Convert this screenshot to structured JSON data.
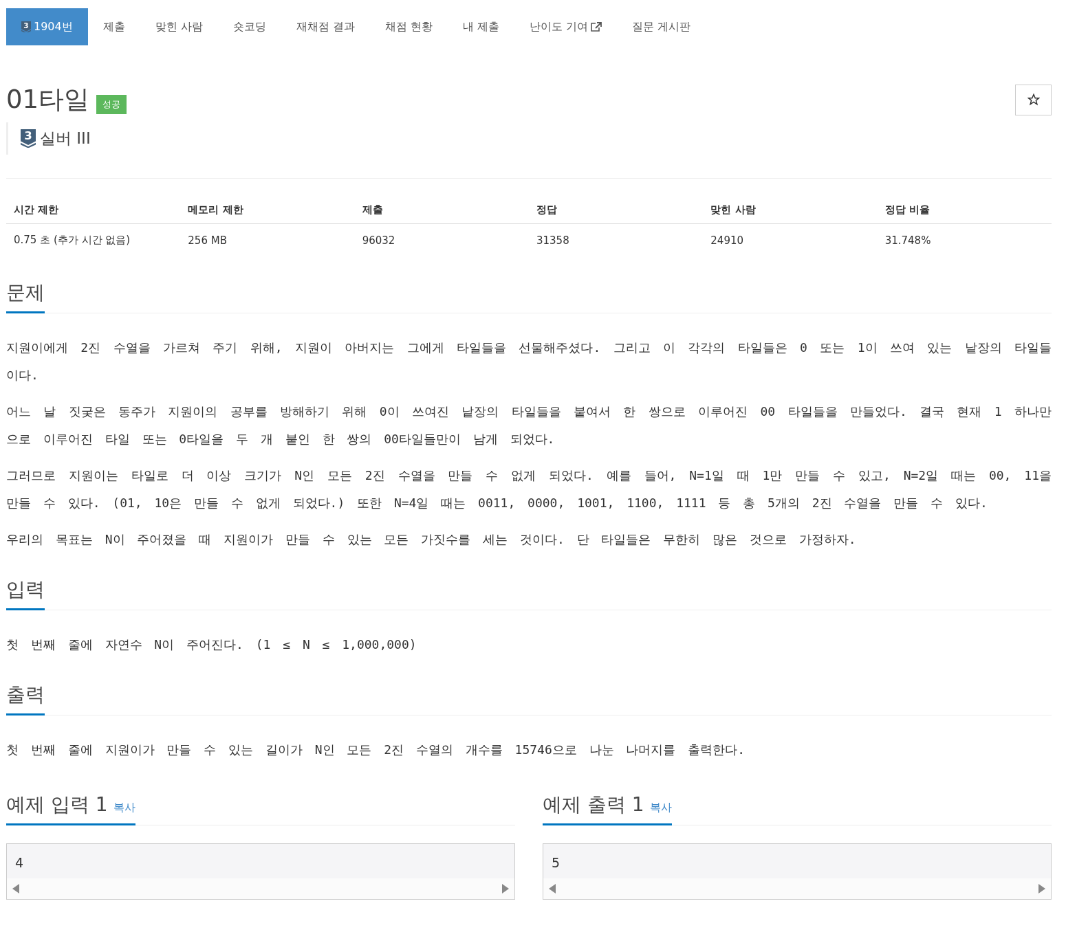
{
  "tabs": [
    {
      "label": "1904번",
      "tier": "3",
      "selected": true,
      "external": false
    },
    {
      "label": "제출",
      "selected": false,
      "external": false
    },
    {
      "label": "맞힌 사람",
      "selected": false,
      "external": false
    },
    {
      "label": "숏코딩",
      "selected": false,
      "external": false
    },
    {
      "label": "재채점 결과",
      "selected": false,
      "external": false
    },
    {
      "label": "채점 현황",
      "selected": false,
      "external": false
    },
    {
      "label": "내 제출",
      "selected": false,
      "external": false
    },
    {
      "label": "난이도 기여",
      "selected": false,
      "external": true
    },
    {
      "label": "질문 게시판",
      "selected": false,
      "external": false
    }
  ],
  "problem": {
    "title": "01타일",
    "result_badge": "성공",
    "tier_number": "3",
    "tier_label": "실버 III"
  },
  "info_table": {
    "columns": [
      "시간 제한",
      "메모리 제한",
      "제출",
      "정답",
      "맞힌 사람",
      "정답 비율"
    ],
    "rows": [
      [
        "0.75 초 (추가 시간 없음)",
        "256 MB",
        "96032",
        "31358",
        "24910",
        "31.748%"
      ]
    ]
  },
  "sections": [
    {
      "heading": "문제",
      "paragraphs": [
        "지원이에게 2진 수열을 가르쳐 주기 위해, 지원이 아버지는 그에게 타일들을 선물해주셨다. 그리고 이 각각의 타일들은 0 또는 1이 쓰여 있는 낱장의 타일들이다.",
        "어느 날 짓궂은 동주가 지원이의 공부를 방해하기 위해 0이 쓰여진 낱장의 타일들을 붙여서 한 쌍으로 이루어진 00 타일들을 만들었다. 결국 현재 1 하나만으로 이루어진 타일 또는 0타일을 두 개 붙인 한 쌍의 00타일들만이 남게 되었다.",
        "그러므로 지원이는 타일로 더 이상 크기가 N인 모든 2진 수열을 만들 수 없게 되었다. 예를 들어, N=1일 때 1만 만들 수 있고, N=2일 때는 00, 11을 만들 수 있다. (01, 10은 만들 수 없게 되었다.) 또한 N=4일 때는 0011, 0000, 1001, 1100, 1111 등 총 5개의 2진 수열을 만들 수 있다.",
        "우리의 목표는 N이 주어졌을 때 지원이가 만들 수 있는 모든 가짓수를 세는 것이다. 단 타일들은 무한히 많은 것으로 가정하자."
      ]
    },
    {
      "heading": "입력",
      "paragraphs": [
        "첫 번째 줄에 자연수 N이 주어진다. (1 ≤ N ≤ 1,000,000)"
      ]
    },
    {
      "heading": "출력",
      "paragraphs": [
        "첫 번째 줄에 지원이가 만들 수 있는 길이가 N인 모든 2진 수열의 개수를 15746으로 나눈 나머지를 출력한다."
      ]
    }
  ],
  "samples": [
    {
      "heading": "예제 입력 1",
      "copy": "복사",
      "value": "4"
    },
    {
      "heading": "예제 출력 1",
      "copy": "복사",
      "value": "5"
    }
  ]
}
